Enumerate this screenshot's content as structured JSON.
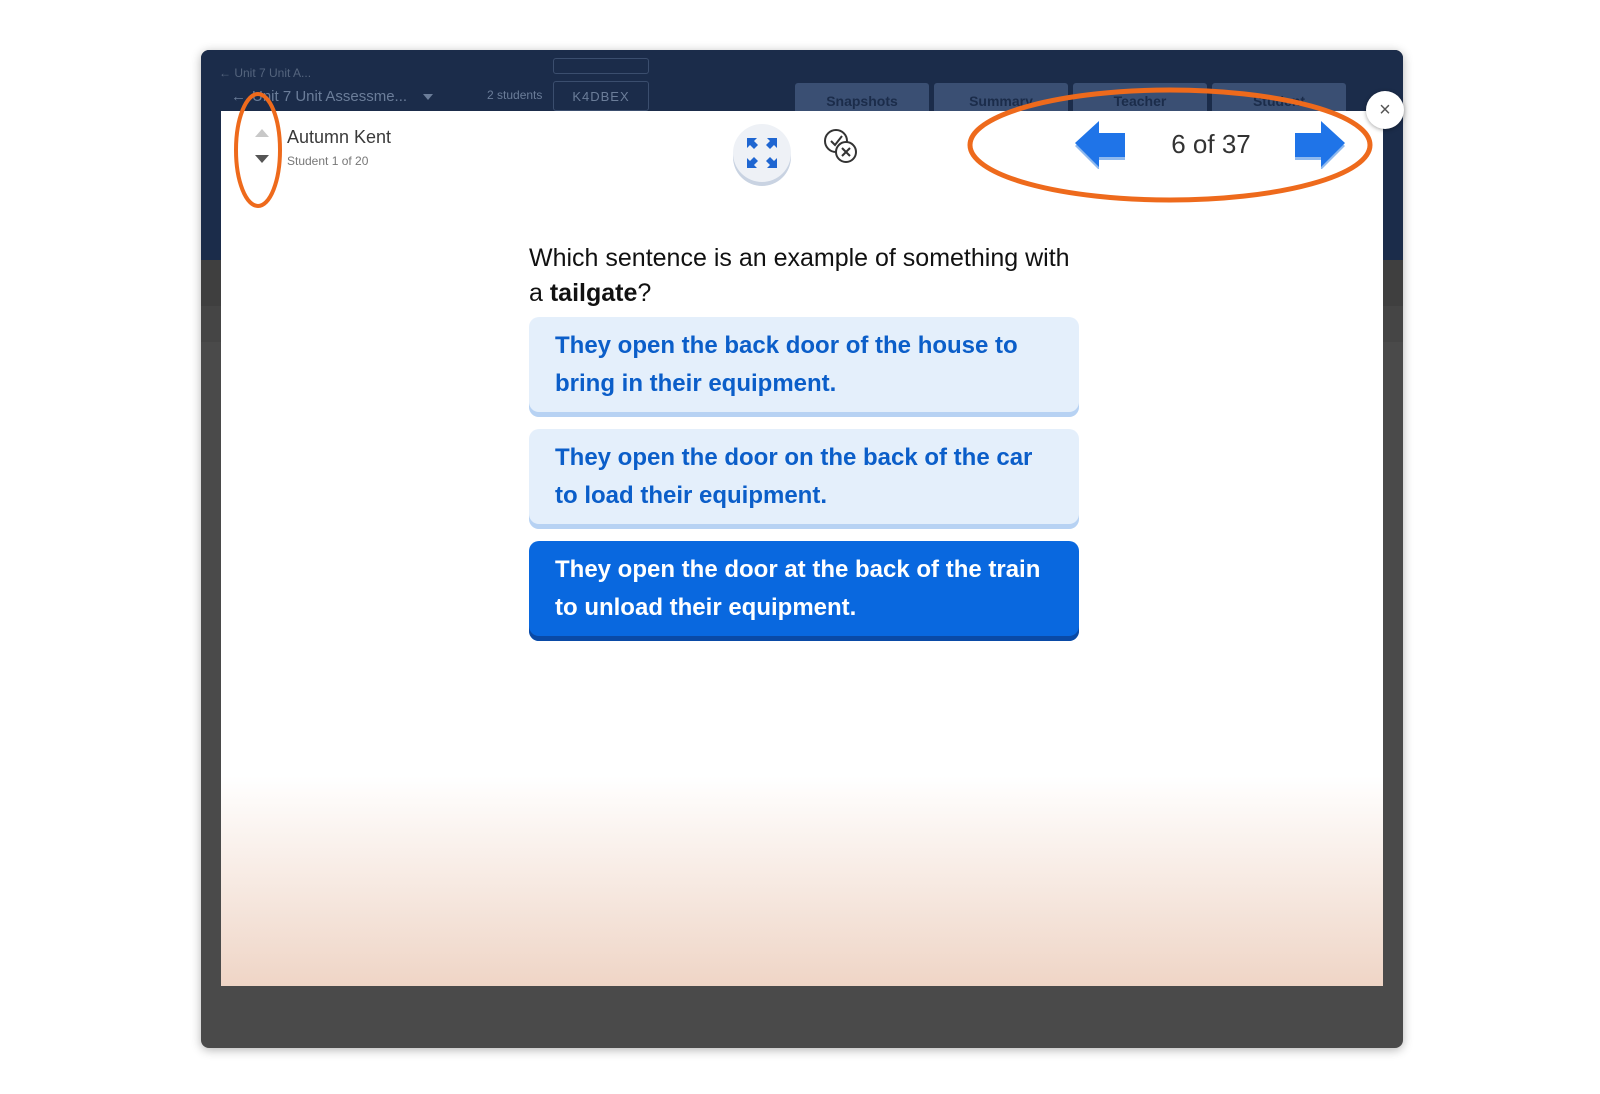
{
  "background_app": {
    "crumb": "← Unit 7 Unit A...",
    "assessment_title": "Unit 7 Unit Assessme...",
    "students_count": "2 students",
    "class_code": "K4DBEX",
    "tabs": [
      "Snapshots",
      "Summary",
      "Teacher",
      "Student"
    ]
  },
  "student": {
    "name": "Autumn Kent",
    "position": "Student 1 of 20"
  },
  "toolbar": {
    "expand_icon": "expand-arrows-icon",
    "toggle_icon": "check-x-toggle-icon"
  },
  "navigation": {
    "counter": "6 of 37",
    "prev_icon": "left-arrow-icon",
    "next_icon": "right-arrow-icon"
  },
  "close": {
    "label": "×"
  },
  "question": {
    "text_before": "Which sentence is an example of something with a ",
    "keyword": "tailgate",
    "text_after": "?"
  },
  "choices": [
    {
      "text": "They open the back door of the house to bring in their equipment.",
      "selected": false
    },
    {
      "text": "They open the door on the back of the car to load their equipment.",
      "selected": false
    },
    {
      "text": "They open the door at the back of the train to unload their equipment.",
      "selected": true
    }
  ],
  "colors": {
    "accent": "#0968df",
    "choice_light": "#e4effb",
    "annotation": "#ee6a1c"
  }
}
